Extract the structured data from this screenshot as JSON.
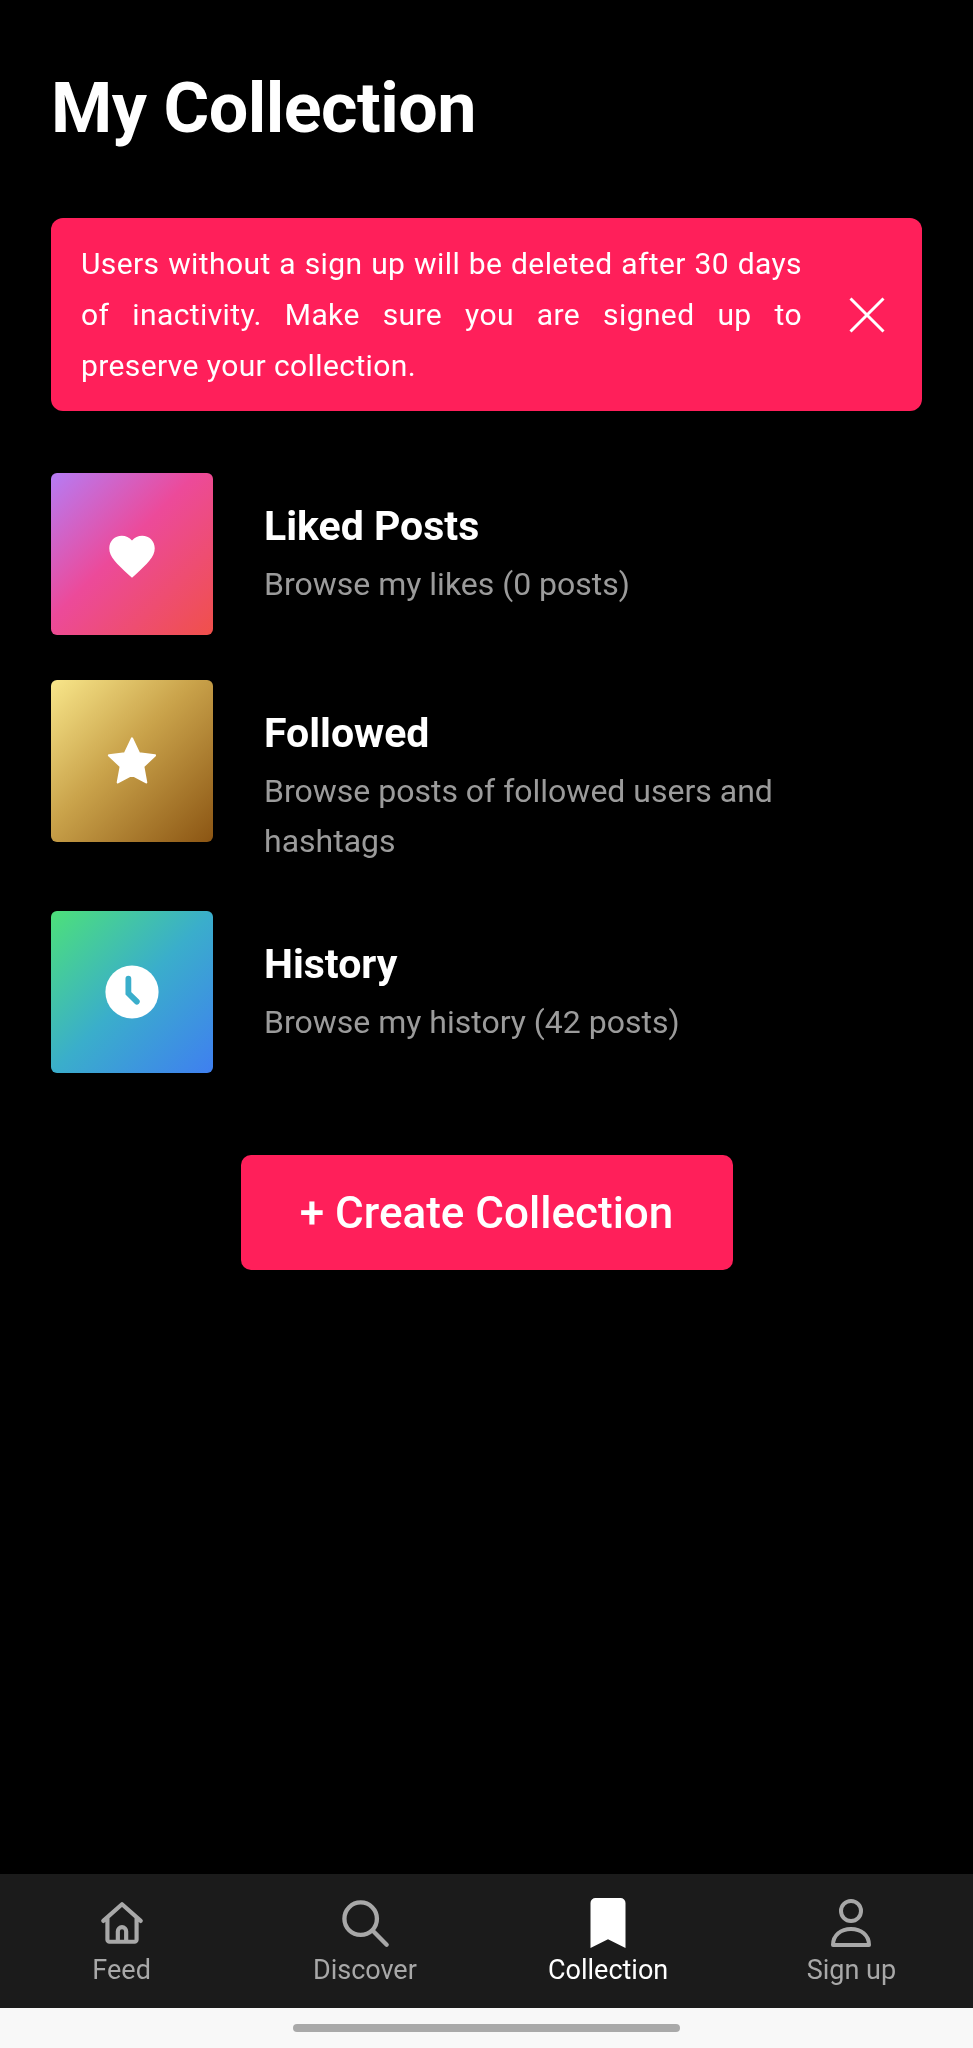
{
  "title": "My Collection",
  "notice": {
    "text": "Users without a sign up will be deleted after 30 days of inactivity. Make sure you are signed up to preserve your collection."
  },
  "collections": [
    {
      "kind": "likes",
      "title": "Liked Posts",
      "subtitle": "Browse my likes (0 posts)"
    },
    {
      "kind": "followed",
      "title": "Followed",
      "subtitle": "Browse posts of followed users and hashtags"
    },
    {
      "kind": "history",
      "title": "History",
      "subtitle": "Browse my history (42 posts)"
    }
  ],
  "create_button": "+ Create Collection",
  "nav": [
    {
      "kind": "home",
      "label": "Feed",
      "selected": false
    },
    {
      "kind": "search",
      "label": "Discover",
      "selected": false
    },
    {
      "kind": "bookmark",
      "label": "Collection",
      "selected": true
    },
    {
      "kind": "user",
      "label": "Sign up",
      "selected": false
    }
  ]
}
